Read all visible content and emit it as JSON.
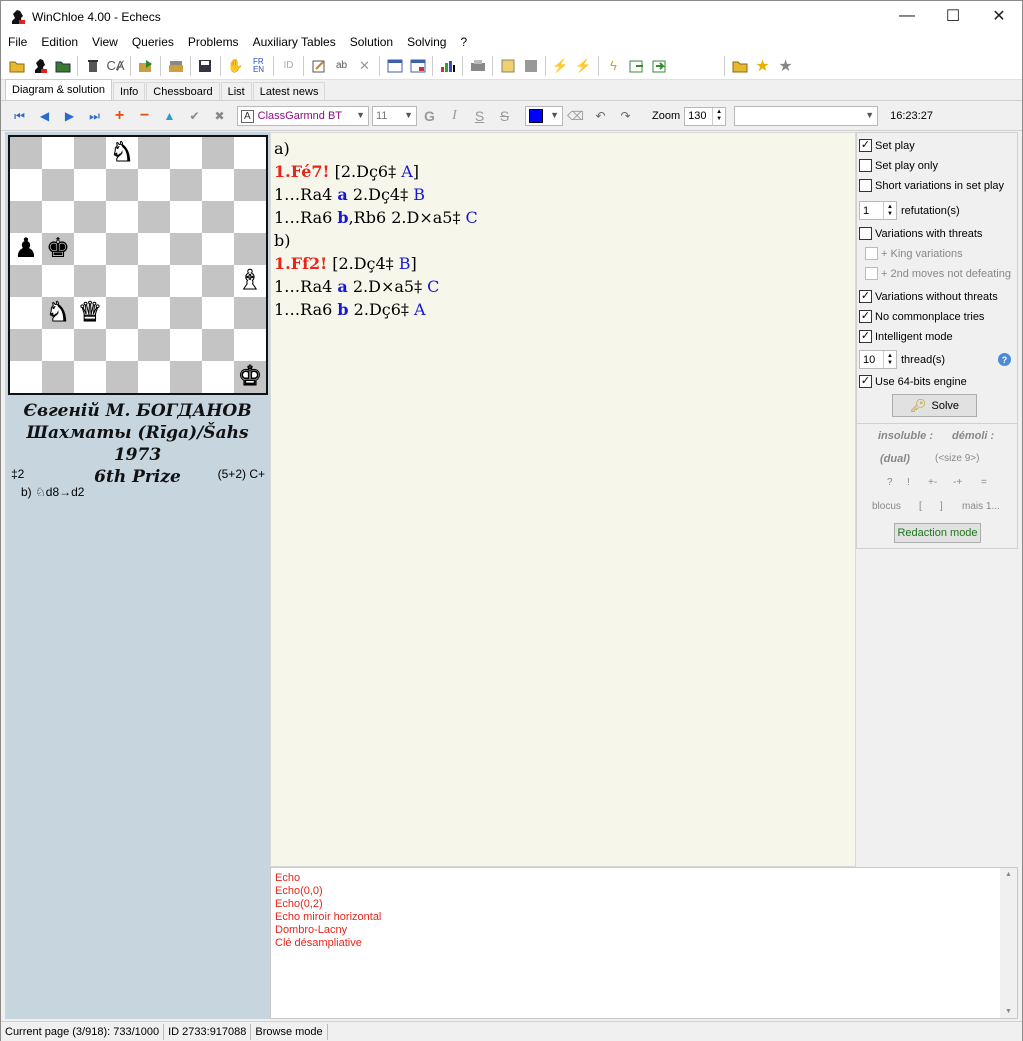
{
  "window": {
    "title": "WinChloe 4.00 - Echecs",
    "minimize": "—",
    "maximize": "☐",
    "close": "✕"
  },
  "menu": [
    "File",
    "Edition",
    "View",
    "Queries",
    "Problems",
    "Auxiliary Tables",
    "Solution",
    "Solving",
    "?"
  ],
  "tabs": [
    "Diagram & solution",
    "Info",
    "Chessboard",
    "List",
    "Latest news"
  ],
  "toolbar2": {
    "font": "ClassGarmnd BT",
    "size": "11",
    "zoom_label": "Zoom",
    "zoom": "130",
    "clock": "16:23:27",
    "bold": "G",
    "italic": "I",
    "underline": "S",
    "strike": "S"
  },
  "board": {
    "pieces": [
      {
        "sq": "d8",
        "glyph": "♞",
        "color": "white"
      },
      {
        "sq": "a5",
        "glyph": "♟",
        "color": "black"
      },
      {
        "sq": "b5",
        "glyph": "♚",
        "color": "black"
      },
      {
        "sq": "h4",
        "glyph": "♝",
        "color": "white"
      },
      {
        "sq": "b3",
        "glyph": "♞",
        "color": "white"
      },
      {
        "sq": "c3",
        "glyph": "♛",
        "color": "white"
      },
      {
        "sq": "h1",
        "glyph": "♚",
        "color": "white"
      }
    ]
  },
  "problem": {
    "author": "Євгеній М. БОГДАНОВ",
    "source": "Шахматы (Rīga)/Šahs 1973",
    "award": "6th Prize",
    "stipulation": "‡2",
    "count": "(5+2)  C+",
    "twin_prefix": "b)",
    "twin_text": "d8→d2"
  },
  "solution": [
    [
      {
        "t": "a)",
        "c": ""
      }
    ],
    [
      {
        "t": "1.Fé7!",
        "c": "red"
      },
      {
        "t": " [2.Dç6‡ ",
        "c": ""
      },
      {
        "t": "A",
        "c": "blue"
      },
      {
        "t": "]",
        "c": ""
      }
    ],
    [
      {
        "t": "1…Ra4 ",
        "c": ""
      },
      {
        "t": "a",
        "c": "bluebold"
      },
      {
        "t": " 2.Dç4‡ ",
        "c": ""
      },
      {
        "t": "B",
        "c": "blue"
      }
    ],
    [
      {
        "t": "1…Ra6 ",
        "c": ""
      },
      {
        "t": "b",
        "c": "bluebold"
      },
      {
        "t": ",Rb6 2.D×a5‡ ",
        "c": ""
      },
      {
        "t": "C",
        "c": "blue"
      }
    ],
    [
      {
        "t": "b)",
        "c": ""
      }
    ],
    [
      {
        "t": "1.Ff2!",
        "c": "red"
      },
      {
        "t": " [2.Dç4‡ ",
        "c": ""
      },
      {
        "t": "B",
        "c": "blue"
      },
      {
        "t": "]",
        "c": ""
      }
    ],
    [
      {
        "t": "1…Ra4 ",
        "c": ""
      },
      {
        "t": "a",
        "c": "bluebold"
      },
      {
        "t": " 2.D×a5‡ ",
        "c": ""
      },
      {
        "t": "C",
        "c": "blue"
      }
    ],
    [
      {
        "t": "1…Ra6 ",
        "c": ""
      },
      {
        "t": "b",
        "c": "bluebold"
      },
      {
        "t": " 2.Dç6‡ ",
        "c": ""
      },
      {
        "t": "A",
        "c": "blue"
      }
    ]
  ],
  "options": {
    "set_play": "Set play",
    "set_play_only": "Set play only",
    "short_variations": "Short variations in set play",
    "refutations_value": "1",
    "refutations_label": "refutation(s)",
    "variations_threats": "Variations with threats",
    "king_variations": "+ King variations",
    "second_moves": "+ 2nd moves not defeating",
    "variations_without": "Variations without threats",
    "no_commonplace": "No commonplace tries",
    "intelligent": "Intelligent mode",
    "threads_value": "10",
    "threads_label": "thread(s)",
    "engine64": "Use 64-bits engine",
    "solve": "Solve"
  },
  "redaction": {
    "insoluble": "insoluble :",
    "demoli": "démoli :",
    "dual": "(dual)",
    "size": "(<size 9>)",
    "q": "?",
    "ex": "!",
    "pm": "+-",
    "mp": "-+",
    "eq": "=",
    "blocus": "blocus",
    "lb": "[",
    "rb": "]",
    "mais": "mais 1...",
    "mode": "Redaction mode"
  },
  "log": [
    "Echo",
    "Echo(0,0)",
    "Echo(0,2)",
    "Echo miroir horizontal",
    "Dombro-Lacny",
    "Clé désampliative"
  ],
  "status": {
    "page": "Current page (3/918): 733/1000",
    "id": "ID 2733:917088",
    "mode": "Browse mode"
  }
}
